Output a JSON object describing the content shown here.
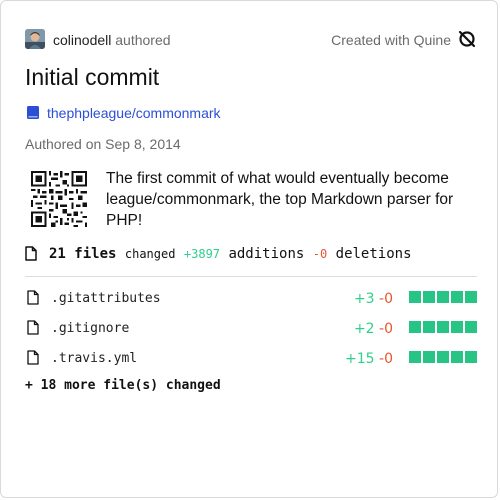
{
  "header": {
    "author_name": "colinodell",
    "author_verb": "authored",
    "created_with": "Created with Quine",
    "avatar_icon": "user-avatar-photo",
    "quine_icon": "quine-logo-icon"
  },
  "commit": {
    "title": "Initial commit",
    "repo": "thephpleague/commonmark",
    "repo_icon": "repo-book-icon",
    "authored_on": "Authored on Sep 8, 2014",
    "description": "The first commit of what would eventually become league/commonmark, the top Markdown parser for PHP!",
    "qr_icon": "qr-code"
  },
  "summary": {
    "files_count": "21 files",
    "changed_label": "changed",
    "additions_value": "+3897",
    "additions_label": "additions",
    "deletions_value": "-0",
    "deletions_label": "deletions"
  },
  "files": [
    {
      "name": ".gitattributes",
      "additions": "+3",
      "deletions": "-0",
      "bars_filled": 5
    },
    {
      "name": ".gitignore",
      "additions": "+2",
      "deletions": "-0",
      "bars_filled": 5
    },
    {
      "name": ".travis.yml",
      "additions": "+15",
      "deletions": "-0",
      "bars_filled": 5
    }
  ],
  "more_files": "+ 18 more file(s) changed",
  "colors": {
    "addition": "#2fcf8e",
    "deletion": "#e9552f",
    "link": "#2b4fd6",
    "bar": "#27c486"
  }
}
